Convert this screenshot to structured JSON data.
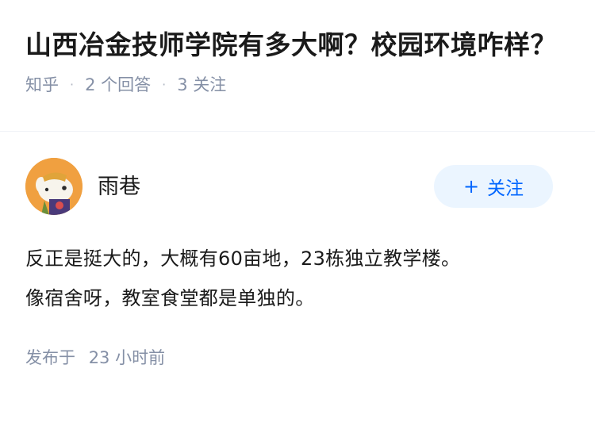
{
  "question": {
    "title": "山西冶金技师学院有多大啊？校园环境咋样？",
    "source": "知乎",
    "answer_count": "2 个回答",
    "follower_count": "3 关注"
  },
  "answer": {
    "author_name": "雨巷",
    "follow_label": "关注",
    "follow_icon": "plus-icon",
    "content_lines": [
      "反正是挺大的，大概有60亩地，23栋独立教学楼。",
      "像宿舍呀，教室食堂都是单独的。"
    ],
    "published_label": "发布于",
    "published_time": "23 小时前"
  },
  "colors": {
    "accent": "#0066ff",
    "button_bg": "#ebf5ff",
    "meta_gray": "#8590a6"
  }
}
